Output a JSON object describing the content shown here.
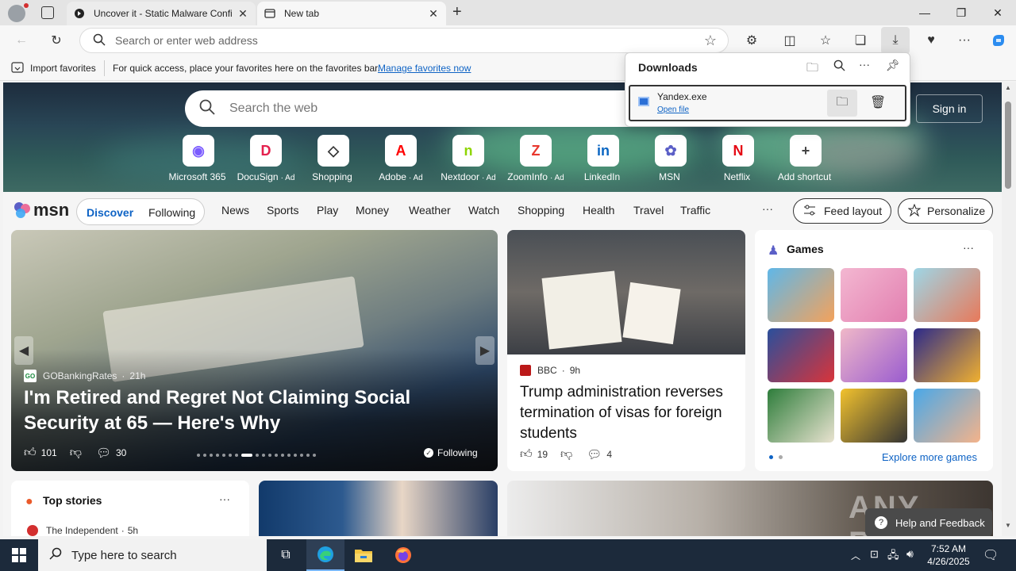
{
  "tabs": [
    {
      "title": "Uncover it - Static Malware Confi",
      "icon": "shield-icon",
      "active": false
    },
    {
      "title": "New tab",
      "icon": "newtab-icon",
      "active": true
    }
  ],
  "address": {
    "placeholder": "Search or enter web address"
  },
  "favorites_bar": {
    "import_label": "Import favorites",
    "hint": "For quick access, place your favorites here on the favorites bar.",
    "manage_link": "Manage favorites now"
  },
  "downloads": {
    "title": "Downloads",
    "item": {
      "filename": "Yandex.exe",
      "action": "Open file"
    }
  },
  "newtab": {
    "search_placeholder": "Search the web",
    "sign_in": "Sign in",
    "tiles": [
      {
        "label": "Microsoft 365",
        "ad": "",
        "glyph": "◉",
        "color": "#7b5cff"
      },
      {
        "label": "DocuSign",
        "ad": "· Ad",
        "glyph": "D",
        "color": "#e4204d"
      },
      {
        "label": "Shopping",
        "ad": "",
        "glyph": "◇",
        "color": "#333333"
      },
      {
        "label": "Adobe",
        "ad": "· Ad",
        "glyph": "A",
        "color": "#ff0000"
      },
      {
        "label": "Nextdoor",
        "ad": "· Ad",
        "glyph": "n",
        "color": "#8ed500"
      },
      {
        "label": "ZoomInfo",
        "ad": "· Ad",
        "glyph": "Z",
        "color": "#e8382e"
      },
      {
        "label": "LinkedIn",
        "ad": "",
        "glyph": "in",
        "color": "#0a66c2"
      },
      {
        "label": "MSN",
        "ad": "",
        "glyph": "✿",
        "color": "#5b5fc7"
      },
      {
        "label": "Netflix",
        "ad": "",
        "glyph": "N",
        "color": "#e50914"
      },
      {
        "label": "Add shortcut",
        "ad": "",
        "glyph": "+",
        "color": "#444444"
      }
    ]
  },
  "msn": {
    "logo": "msn",
    "tabs": [
      "Discover",
      "Following"
    ],
    "links": [
      "News",
      "Sports",
      "Play",
      "Money",
      "Weather",
      "Watch",
      "Shopping",
      "Health",
      "Travel",
      "Traffic"
    ],
    "more": "···",
    "feed_layout": "Feed layout",
    "personalize": "Personalize"
  },
  "hero_story": {
    "source": "GOBankingRates",
    "source_badge": "GO",
    "age": "21h",
    "headline": "I'm Retired and Regret Not Claiming Social Security at 65 — Here's Why",
    "likes": "101",
    "comments": "30",
    "following": "Following"
  },
  "side_story": {
    "source": "BBC",
    "age": "9h",
    "headline": "Trump administration reverses termination of visas for foreign students",
    "likes": "19",
    "comments": "4"
  },
  "games": {
    "title": "Games",
    "more": "···",
    "explore": "Explore more games"
  },
  "top_stories": {
    "title": "Top stories",
    "more": "···",
    "first_source": "The Independent",
    "first_age": "5h"
  },
  "help": {
    "label": "Help and Feedback"
  },
  "watermark": "ANY RUN",
  "taskbar": {
    "search_placeholder": "Type here to search",
    "time": "7:52 AM",
    "date": "4/26/2025"
  }
}
